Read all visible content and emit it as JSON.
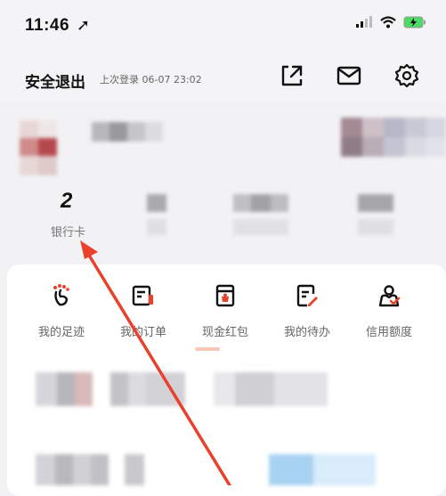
{
  "status_bar": {
    "time": "11:46"
  },
  "header": {
    "logout_label": "安全退出",
    "last_login": "上次登录 06-07 23:02"
  },
  "stats": {
    "bank_card_count": "2",
    "bank_card_label": "银行卡"
  },
  "menu": {
    "items": [
      {
        "label": "我的足迹",
        "icon": "footprint-icon"
      },
      {
        "label": "我的订单",
        "icon": "order-icon"
      },
      {
        "label": "现金红包",
        "icon": "red-packet-icon"
      },
      {
        "label": "我的待办",
        "icon": "todo-icon"
      },
      {
        "label": "信用额度",
        "icon": "credit-limit-icon"
      }
    ]
  },
  "colors": {
    "accent": "#e8412c",
    "arrow": "#e8412c"
  }
}
